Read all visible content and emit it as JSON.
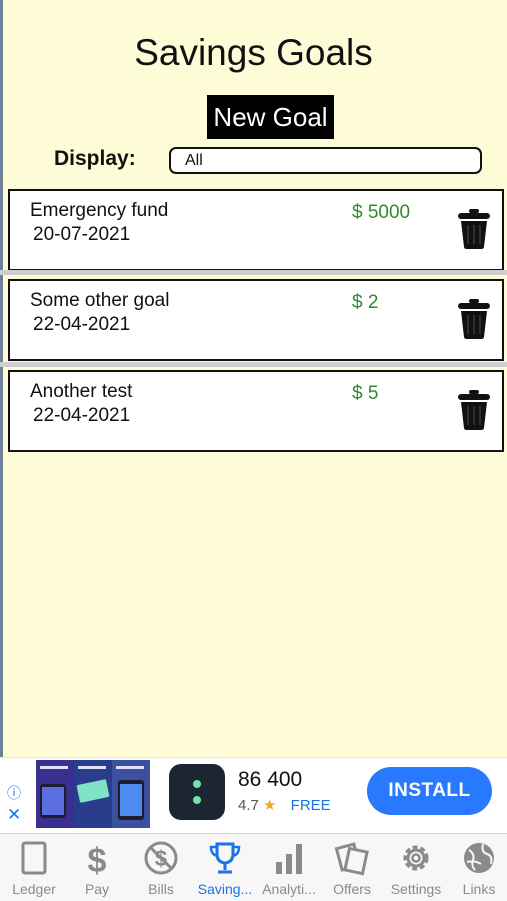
{
  "page": {
    "title": "Savings Goals",
    "new_goal_label": "New Goal"
  },
  "filter": {
    "label": "Display:",
    "value": "All"
  },
  "goals": [
    {
      "name": "Emergency fund",
      "date": "20-07-2021",
      "amount": "$ 5000"
    },
    {
      "name": "Some other goal",
      "date": "22-04-2021",
      "amount": "$ 2"
    },
    {
      "name": "Another test",
      "date": "22-04-2021",
      "amount": "$ 5"
    }
  ],
  "ad": {
    "app_name": "86 400",
    "rating": "4.7",
    "price": "FREE",
    "install_label": "INSTALL"
  },
  "tabs": [
    {
      "label": "Ledger",
      "icon": "ledger-icon"
    },
    {
      "label": "Pay",
      "icon": "dollar-icon"
    },
    {
      "label": "Bills",
      "icon": "no-dollar-icon"
    },
    {
      "label": "Saving...",
      "icon": "trophy-icon",
      "active": true
    },
    {
      "label": "Analyti...",
      "icon": "bar-chart-icon"
    },
    {
      "label": "Offers",
      "icon": "offers-icon"
    },
    {
      "label": "Settings",
      "icon": "gear-icon"
    },
    {
      "label": "Links",
      "icon": "globe-icon"
    }
  ],
  "colors": {
    "background": "#fdfcd6",
    "amount": "#2e8b2e",
    "active_tab": "#1a73e8",
    "install": "#2979ff"
  }
}
